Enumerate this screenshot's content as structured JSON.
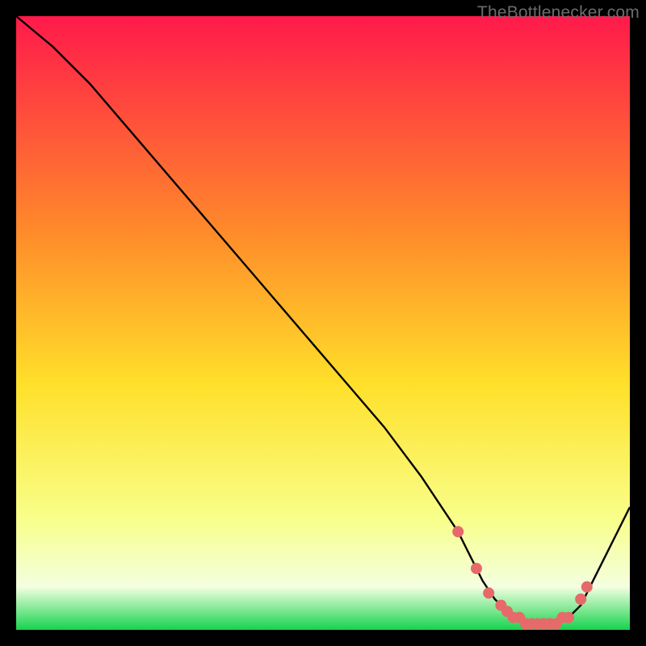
{
  "attribution": "TheBottlenecker.com",
  "colors": {
    "bg": "#000000",
    "line": "#000000",
    "marker_fill": "#e66a6a",
    "marker_stroke": "#e66a6a",
    "gradient_top": "#ff1a4b",
    "gradient_mid_upper": "#ff8a2a",
    "gradient_mid": "#ffe02a",
    "gradient_lower": "#f8ff8a",
    "gradient_band": "#f3ffe0",
    "gradient_green": "#17d34e"
  },
  "chart_data": {
    "type": "line",
    "title": "",
    "xlabel": "",
    "ylabel": "",
    "xlim": [
      0,
      100
    ],
    "ylim": [
      0,
      100
    ],
    "series": [
      {
        "name": "bottleneck-curve",
        "x": [
          0,
          6,
          12,
          18,
          24,
          30,
          36,
          42,
          48,
          54,
          60,
          66,
          72,
          74,
          76,
          78,
          80,
          82,
          84,
          86,
          88,
          90,
          92,
          94,
          96,
          100
        ],
        "y": [
          100,
          95,
          89,
          82,
          75,
          68,
          61,
          54,
          47,
          40,
          33,
          25,
          16,
          12,
          8,
          5,
          3,
          2,
          1,
          1,
          1,
          2,
          4,
          8,
          12,
          20
        ]
      }
    ],
    "markers": {
      "name": "optimal-range",
      "x": [
        72,
        75,
        77,
        79,
        80,
        81,
        82,
        83,
        84,
        85,
        86,
        87,
        88,
        89,
        90,
        92,
        93
      ],
      "y": [
        16,
        10,
        6,
        4,
        3,
        2,
        2,
        1,
        1,
        1,
        1,
        1,
        1,
        2,
        2,
        5,
        7
      ]
    }
  }
}
